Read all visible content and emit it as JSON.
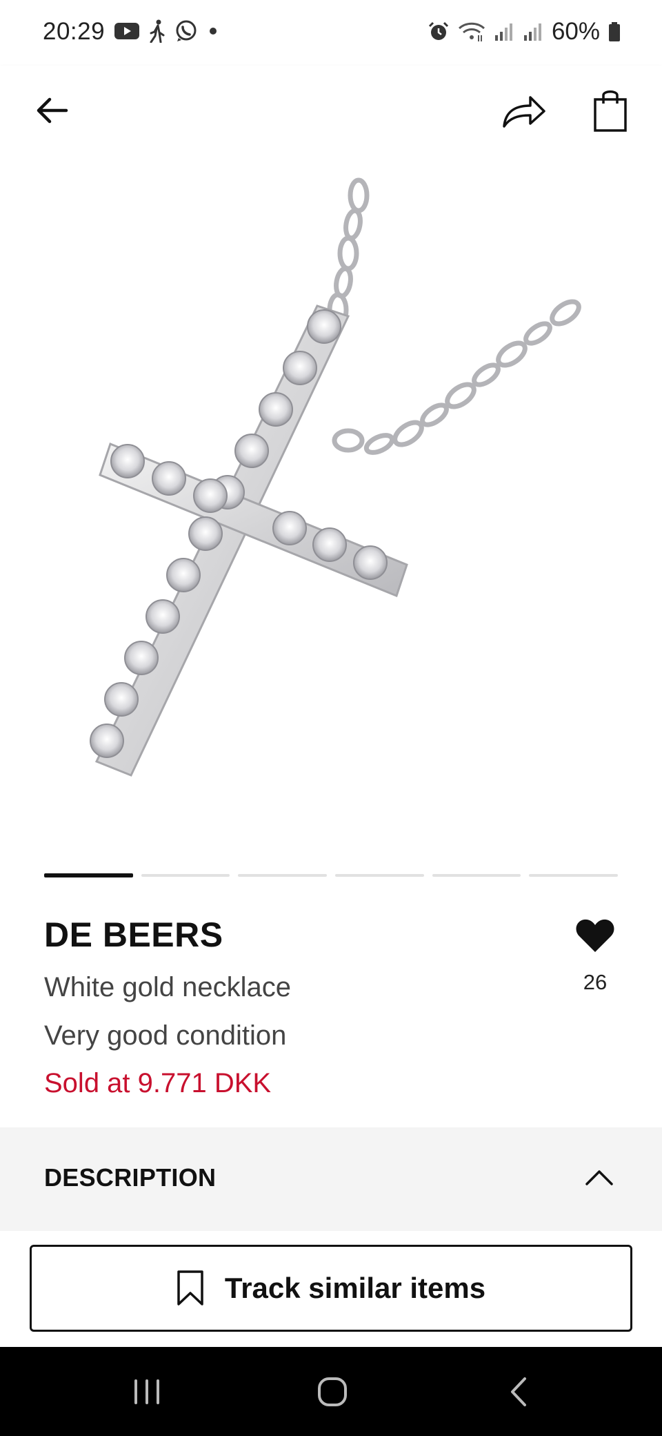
{
  "status_bar": {
    "time": "20:29",
    "battery": "60%",
    "left_icons": [
      "youtube-icon",
      "walking-icon",
      "whatsapp-icon",
      "dot-icon"
    ],
    "right_icons": [
      "alarm-icon",
      "wifi-icon",
      "signal-icon",
      "signal-icon",
      "battery-icon"
    ]
  },
  "header": {
    "icons": [
      "arrow-left-icon",
      "share-icon",
      "shopping-bag-icon"
    ]
  },
  "carousel": {
    "count": 6,
    "active_index": 0
  },
  "product": {
    "brand": "DE BEERS",
    "name": "White gold necklace",
    "condition": "Very good condition",
    "price": "Sold at 9.771 DKK",
    "favorites": "26",
    "price_color": "#c8102e"
  },
  "description": {
    "title": "DESCRIPTION"
  },
  "actions": {
    "track_label": "Track similar items"
  },
  "nav": {
    "icons": [
      "recent-apps-icon",
      "home-icon",
      "back-icon"
    ]
  }
}
